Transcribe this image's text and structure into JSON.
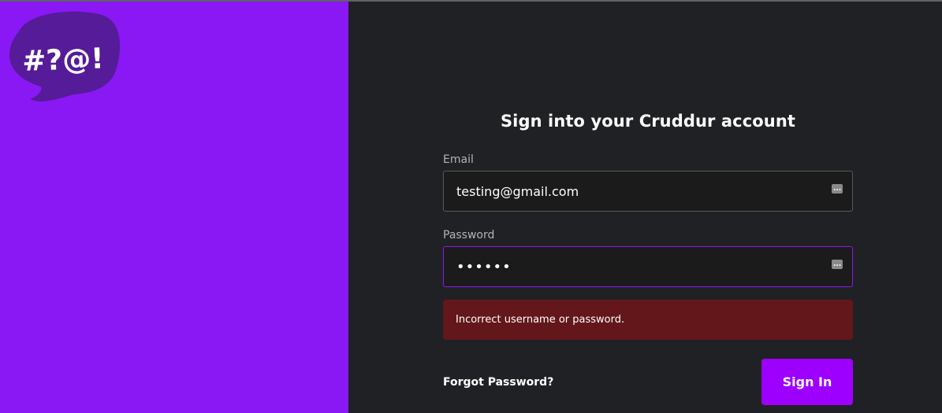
{
  "brand": {
    "logo_text": "#?@!",
    "logo_bubble_color": "#561b98",
    "left_panel_color": "#8a18f5"
  },
  "form": {
    "title": "Sign into your Cruddur account",
    "email": {
      "label": "Email",
      "value": "testing@gmail.com",
      "icon": "autofill-icon"
    },
    "password": {
      "label": "Password",
      "value": "••••••",
      "icon": "autofill-icon"
    },
    "error_message": "Incorrect username or password.",
    "forgot_link": "Forgot Password?",
    "submit_label": "Sign In"
  },
  "colors": {
    "accent": "#9d00ff",
    "error_bg": "#63171a",
    "background": "#202124"
  }
}
